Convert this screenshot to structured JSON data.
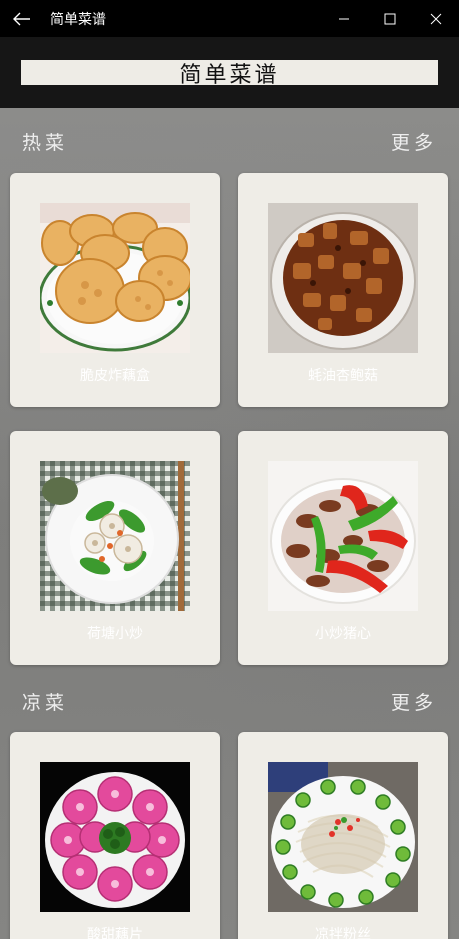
{
  "window": {
    "title": "简单菜谱",
    "back_icon": "arrow-left-icon",
    "min_icon": "minimize-icon",
    "max_icon": "maximize-icon",
    "close_icon": "close-icon"
  },
  "header": {
    "title": "简单菜谱"
  },
  "sections": [
    {
      "title": "热菜",
      "more": "更多",
      "cards": [
        {
          "name": "脆皮炸藕盒",
          "image": "fried-lotus-root-cakes"
        },
        {
          "name": "蚝油杏鲍菇",
          "image": "oyster-sauce-king-oyster-mushroom"
        },
        {
          "name": "荷塘小炒",
          "image": "lotus-pond-stir-fry"
        },
        {
          "name": "小炒猪心",
          "image": "stir-fried-pork-heart"
        }
      ]
    },
    {
      "title": "凉菜",
      "more": "更多",
      "cards": [
        {
          "name": "酸甜藕片",
          "image": "sweet-sour-lotus-slices"
        },
        {
          "name": "凉拌粉丝",
          "image": "cold-vermicelli-salad"
        }
      ]
    }
  ],
  "colors": {
    "titlebar": "#000000",
    "header": "#161616",
    "card": "#efede7",
    "accent_text": "#ffffff"
  }
}
